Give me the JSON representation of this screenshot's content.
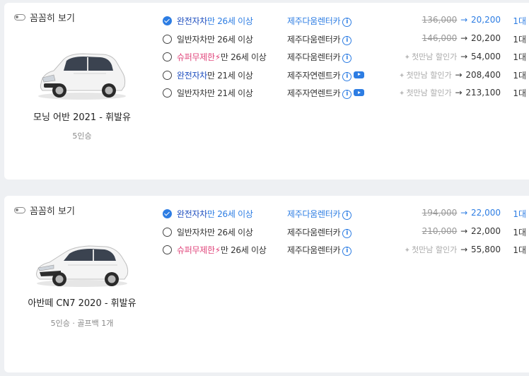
{
  "cards": [
    {
      "detail_label": "꼼꼼히 보기",
      "car_name": "모닝 어반 2021 - 휘발유",
      "car_spec": "5인승",
      "options": [
        {
          "ins_type": "완전자차",
          "age": "만 26세 이상",
          "company": "제주다움렌터카",
          "orig_price": "136,000",
          "price": "20,200",
          "count": "1대"
        },
        {
          "ins_type": "일반자차",
          "age": "만 26세 이상",
          "company": "제주다움렌터카",
          "orig_price": "146,000",
          "price": "20,200",
          "count": "1대"
        },
        {
          "ins_type": "슈퍼무제한",
          "age": "만 26세 이상",
          "company": "제주다움렌터카",
          "discount_label": "첫만남 할인가",
          "price": "54,000",
          "count": "1대"
        },
        {
          "ins_type": "완전자차",
          "age": "만 21세 이상",
          "company": "제주자연렌트카",
          "discount_label": "첫만남 할인가",
          "price": "208,400",
          "count": "1대"
        },
        {
          "ins_type": "일반자차",
          "age": "만 21세 이상",
          "company": "제주자연렌트카",
          "discount_label": "첫만남 할인가",
          "price": "213,100",
          "count": "1대"
        }
      ]
    },
    {
      "detail_label": "꼼꼼히 보기",
      "car_name": "아반떼 CN7 2020 - 휘발유",
      "car_spec": "5인승 · 골프백 1개",
      "options": [
        {
          "ins_type": "완전자차",
          "age": "만 26세 이상",
          "company": "제주다움렌터카",
          "orig_price": "194,000",
          "price": "22,000",
          "count": "1대"
        },
        {
          "ins_type": "일반자차",
          "age": "만 26세 이상",
          "company": "제주다움렌터카",
          "orig_price": "210,000",
          "price": "22,000",
          "count": "1대"
        },
        {
          "ins_type": "슈퍼무제한",
          "age": "만 26세 이상",
          "company": "제주다움렌터카",
          "discount_label": "첫만남 할인가",
          "price": "55,800",
          "count": "1대"
        }
      ]
    }
  ],
  "icons": {
    "info": "info-icon",
    "video": "play-video-icon",
    "bolt": "lightning-icon",
    "sparkle": "sparkle-icon",
    "arrow": "arrow-right-icon"
  },
  "colors": {
    "accent_blue": "#2d7de3",
    "full_coverage": "#1f4fbf",
    "super_unlimited": "#e0457b"
  }
}
